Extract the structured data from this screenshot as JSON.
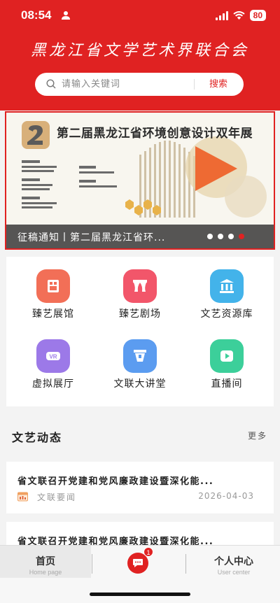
{
  "status_bar": {
    "time": "08:54",
    "battery": "80"
  },
  "header": {
    "org_title": "黑龙江省文学艺术界联合会"
  },
  "search": {
    "placeholder": "请输入关键词",
    "button_label": "搜索"
  },
  "banner": {
    "headline": "第二届黑龙江省环境创意设计双年展",
    "caption": "征稿通知丨第二届黑龙江省环...",
    "slide_count": 4,
    "active_slide": 4
  },
  "grid": {
    "items": [
      {
        "label": "臻艺展馆",
        "icon": "gallery-icon",
        "color": "#f26f57"
      },
      {
        "label": "臻艺剧场",
        "icon": "theater-icon",
        "color": "#f2566a"
      },
      {
        "label": "文艺资源库",
        "icon": "library-icon",
        "color": "#43b3ea"
      },
      {
        "label": "虚拟展厅",
        "icon": "vr-icon",
        "color": "#9c79e8"
      },
      {
        "label": "文联大讲堂",
        "icon": "lecture-icon",
        "color": "#5b9cf0"
      },
      {
        "label": "直播间",
        "icon": "live-icon",
        "color": "#3ccf9a"
      }
    ]
  },
  "news": {
    "section_title": "文艺动态",
    "more_label": "更多",
    "items": [
      {
        "title": "省文联召开党建和党风廉政建设暨深化能...",
        "category": "文联要闻",
        "date": "2026-04-03"
      },
      {
        "title": "省文联召开党建和党风廉政建设暨深化能..."
      }
    ]
  },
  "tabbar": {
    "home_label": "首页",
    "home_sub": "Home page",
    "message_badge": "1",
    "user_label": "个人中心",
    "user_sub": "User center"
  },
  "colors": {
    "brand_red": "#e02222"
  }
}
